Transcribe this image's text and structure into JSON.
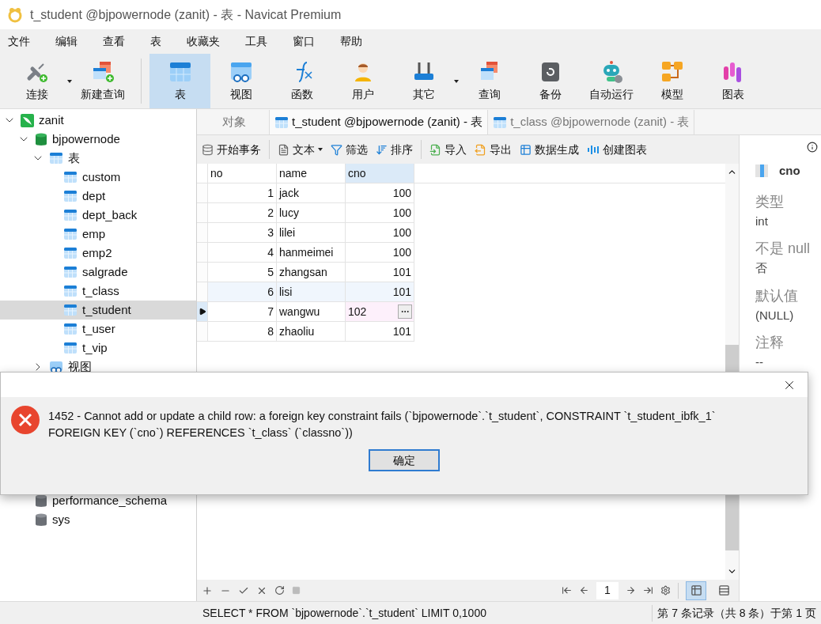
{
  "window": {
    "title": "t_student @bjpowernode (zanit) - 表 - Navicat Premium"
  },
  "menu": [
    "文件",
    "编辑",
    "查看",
    "表",
    "收藏夹",
    "工具",
    "窗口",
    "帮助"
  ],
  "toolbar": [
    {
      "kind": "connect",
      "label": "连接",
      "selected": false,
      "dropdown": true
    },
    {
      "kind": "new-query",
      "label": "新建查询",
      "selected": false,
      "dropdown": false
    },
    {
      "kind": "table",
      "label": "表",
      "selected": true,
      "dropdown": false
    },
    {
      "kind": "view",
      "label": "视图",
      "selected": false,
      "dropdown": false
    },
    {
      "kind": "function",
      "label": "函数",
      "selected": false,
      "dropdown": false
    },
    {
      "kind": "user",
      "label": "用户",
      "selected": false,
      "dropdown": false
    },
    {
      "kind": "tools",
      "label": "其它",
      "selected": false,
      "dropdown": true
    },
    {
      "kind": "query",
      "label": "查询",
      "selected": false,
      "dropdown": false
    },
    {
      "kind": "backup",
      "label": "备份",
      "selected": false,
      "dropdown": false
    },
    {
      "kind": "robot",
      "label": "自动运行",
      "selected": false,
      "dropdown": false
    },
    {
      "kind": "model",
      "label": "模型",
      "selected": false,
      "dropdown": false
    },
    {
      "kind": "chart",
      "label": "图表",
      "selected": false,
      "dropdown": false
    }
  ],
  "tree": [
    {
      "kind": "connection",
      "label": "zanit",
      "expanded": true,
      "selected": false,
      "children": [
        {
          "kind": "database",
          "label": "bjpowernode",
          "expanded": true,
          "selected": false,
          "children": [
            {
              "kind": "table-group",
              "label": "表",
              "expanded": true,
              "selected": false,
              "children": [
                {
                  "kind": "table",
                  "label": "custom",
                  "selected": false
                },
                {
                  "kind": "table",
                  "label": "dept",
                  "selected": false
                },
                {
                  "kind": "table",
                  "label": "dept_back",
                  "selected": false
                },
                {
                  "kind": "table",
                  "label": "emp",
                  "selected": false
                },
                {
                  "kind": "table",
                  "label": "emp2",
                  "selected": false
                },
                {
                  "kind": "table",
                  "label": "salgrade",
                  "selected": false
                },
                {
                  "kind": "table",
                  "label": "t_class",
                  "selected": false
                },
                {
                  "kind": "table",
                  "label": "t_student",
                  "selected": true
                },
                {
                  "kind": "table",
                  "label": "t_user",
                  "selected": false
                },
                {
                  "kind": "table",
                  "label": "t_vip",
                  "selected": false
                }
              ]
            },
            {
              "kind": "view-group",
              "label": "视图",
              "expanded": false,
              "selected": false
            }
          ]
        },
        {
          "kind": "database",
          "label": "performance_schema",
          "expanded": false,
          "selected": false
        },
        {
          "kind": "database",
          "label": "sys",
          "expanded": false,
          "selected": false
        }
      ]
    }
  ],
  "tabs": [
    {
      "kind": "objects",
      "label": "对象",
      "selected": false
    },
    {
      "kind": "table",
      "label": "t_student @bjpowernode (zanit) - 表",
      "selected": true
    },
    {
      "kind": "table",
      "label": "t_class @bjpowernode (zanit) - 表",
      "selected": false
    }
  ],
  "grid_toolbar": [
    {
      "kind": "transaction",
      "label": "开始事务",
      "dropdown": false
    },
    {
      "kind": "text",
      "label": "文本",
      "dropdown": true
    },
    {
      "kind": "filter",
      "label": "筛选",
      "dropdown": false
    },
    {
      "kind": "sort",
      "label": "排序",
      "dropdown": false
    },
    {
      "kind": "import",
      "label": "导入",
      "dropdown": false
    },
    {
      "kind": "export",
      "label": "导出",
      "dropdown": false
    },
    {
      "kind": "generate",
      "label": "数据生成",
      "dropdown": false
    },
    {
      "kind": "chart",
      "label": "创建图表",
      "dropdown": false
    }
  ],
  "table": {
    "columns": [
      {
        "label": "no",
        "selected": false
      },
      {
        "label": "name",
        "selected": false
      },
      {
        "label": "cno",
        "selected": true
      }
    ],
    "rows": [
      {
        "no": "1",
        "name": "jack",
        "cno": "100",
        "current": false,
        "hover": false
      },
      {
        "no": "2",
        "name": "lucy",
        "cno": "100",
        "current": false,
        "hover": false
      },
      {
        "no": "3",
        "name": "lilei",
        "cno": "100",
        "current": false,
        "hover": false
      },
      {
        "no": "4",
        "name": "hanmeimei",
        "cno": "100",
        "current": false,
        "hover": false
      },
      {
        "no": "5",
        "name": "zhangsan",
        "cno": "101",
        "current": false,
        "hover": false
      },
      {
        "no": "6",
        "name": "lisi",
        "cno": "101",
        "current": false,
        "hover": true
      },
      {
        "no": "7",
        "name": "wangwu",
        "cno": "102",
        "current": true,
        "hover": false
      },
      {
        "no": "8",
        "name": "zhaoliu",
        "cno": "101",
        "current": false,
        "hover": false
      }
    ]
  },
  "pager": {
    "page": "1",
    "views": [
      {
        "kind": "grid",
        "selected": true
      },
      {
        "kind": "form",
        "selected": false
      }
    ]
  },
  "field_info": {
    "title": "cno",
    "properties": [
      {
        "label": "类型",
        "value": "int"
      },
      {
        "label": "不是 null",
        "value": "否"
      },
      {
        "label": "默认值",
        "value": "(NULL)"
      },
      {
        "label": "注释",
        "value": "--"
      }
    ]
  },
  "dialog": {
    "message": "1452 - Cannot add or update a child row: a foreign key constraint fails (`bjpowernode`.`t_student`, CONSTRAINT `t_student_ibfk_1` FOREIGN KEY (`cno`) REFERENCES `t_class` (`classno`))",
    "button": "确定"
  },
  "status_bar": {
    "sql": "SELECT * FROM `bjpowernode`.`t_student` LIMIT 0,1000",
    "record": "第 7 条记录（共 8 条）于第 1 页"
  }
}
